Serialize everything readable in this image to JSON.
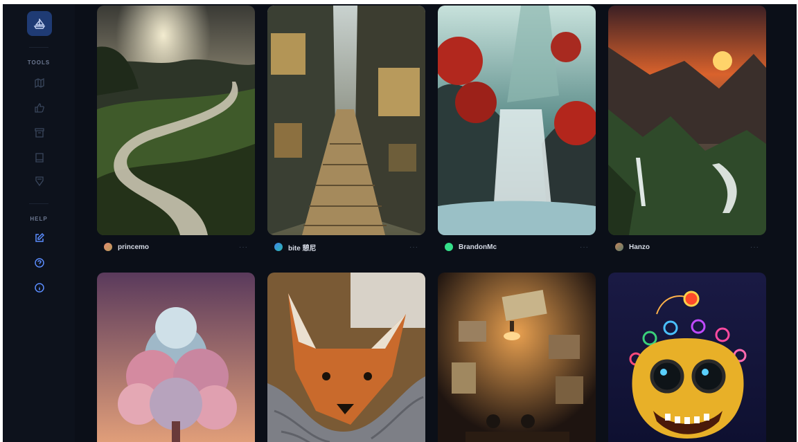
{
  "sidebar": {
    "tools_label": "TOOLS",
    "help_label": "HELP",
    "tool_icons": [
      "map-icon",
      "thumbs-up-icon",
      "archive-icon",
      "book-icon",
      "bookmark-icon"
    ],
    "help_icons": [
      "edit-icon",
      "help-circle-icon",
      "info-icon"
    ]
  },
  "gallery": {
    "items": [
      {
        "author": "princemo",
        "avatar_color": "#d9826a",
        "more": "···"
      },
      {
        "author": "bite 憩尼",
        "avatar_color": "#3f86e8",
        "more": "···"
      },
      {
        "author": "BrandonMc",
        "avatar_color": "#35e08a",
        "more": "···"
      },
      {
        "author": "Hanzo",
        "avatar_color": "#c4855b",
        "more": "···"
      }
    ]
  },
  "colors": {
    "background": "#0b0f18",
    "sidebar": "#0d121c",
    "accent": "#5b8dff",
    "logo_bg": "#1f3b74"
  }
}
